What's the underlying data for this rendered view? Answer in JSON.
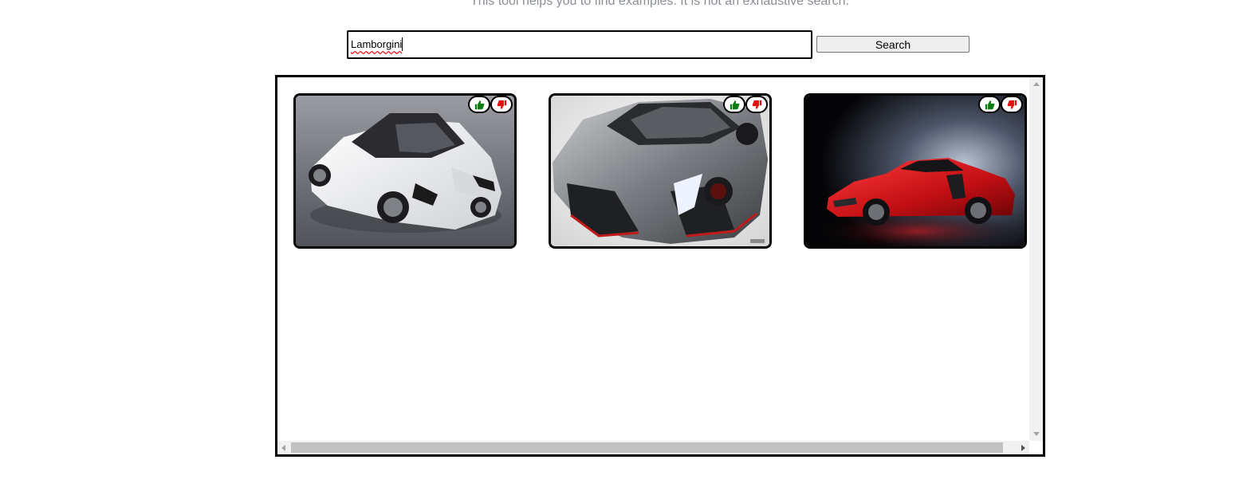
{
  "header": {
    "help_text": "This tool helps you to find examples. It is not an exhaustive search."
  },
  "search": {
    "value": "Lamborgini",
    "button_label": "Search"
  },
  "results": [
    {
      "subject": "white convertible sports car",
      "upvote_icon": "thumbs-up-icon",
      "downvote_icon": "thumbs-down-icon"
    },
    {
      "subject": "silver hypercar",
      "upvote_icon": "thumbs-up-icon",
      "downvote_icon": "thumbs-down-icon"
    },
    {
      "subject": "red sports car",
      "upvote_icon": "thumbs-up-icon",
      "downvote_icon": "thumbs-down-icon"
    }
  ],
  "colors": {
    "upvote": "#0a7a12",
    "downvote": "#e01010",
    "panel_border": "#000000",
    "help_text": "#8a8f96"
  }
}
